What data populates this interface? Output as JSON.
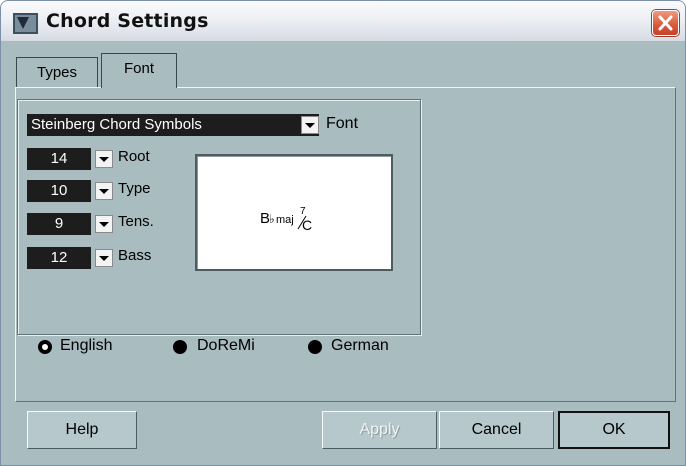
{
  "window": {
    "title": "Chord Settings"
  },
  "tabs": [
    {
      "label": "Types",
      "active": false
    },
    {
      "label": "Font",
      "active": true
    }
  ],
  "font": {
    "selected": "Steinberg Chord Symbols",
    "label": "Font"
  },
  "sizes": [
    {
      "value": "14",
      "label": "Root"
    },
    {
      "value": "10",
      "label": "Type"
    },
    {
      "value": "9",
      "label": "Tens."
    },
    {
      "value": "12",
      "label": "Bass"
    }
  ],
  "preview": {
    "root": "B",
    "accidental": "♭",
    "type": "maj",
    "tension": "7",
    "bass": "C"
  },
  "naming": [
    {
      "label": "English",
      "selected": true
    },
    {
      "label": "DoReMi",
      "selected": false
    },
    {
      "label": "German",
      "selected": false
    }
  ],
  "buttons": {
    "help": "Help",
    "apply": "Apply",
    "cancel": "Cancel",
    "ok": "OK"
  },
  "colors": {
    "dialog_bg": "#a9bcc0",
    "close_button": "#d8583a",
    "field_bg": "#1d1d1d"
  }
}
